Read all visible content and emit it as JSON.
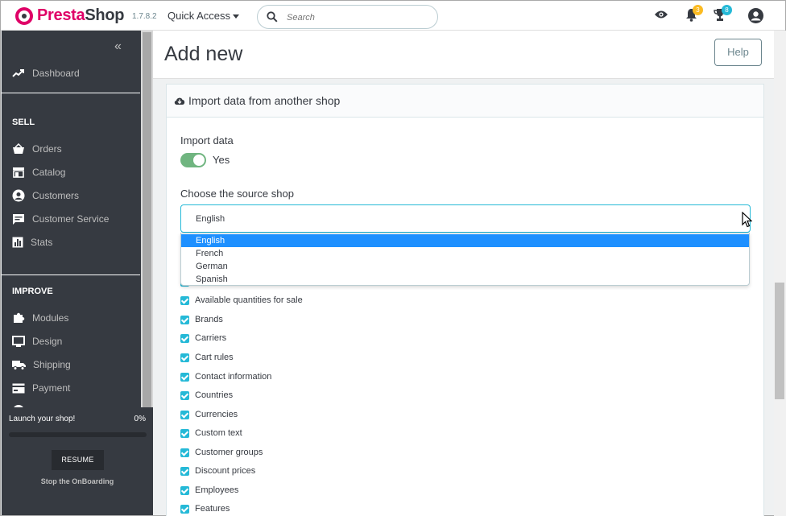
{
  "app": {
    "brand_presta": "Presta",
    "brand_shop": "Shop",
    "version": "1.7.8.2",
    "quick_access": "Quick Access",
    "search_placeholder": "Search",
    "notifications_count": "3",
    "trophy_count": "8"
  },
  "sidebar": {
    "dashboard": "Dashboard",
    "sell_heading": "SELL",
    "sell_items": [
      "Orders",
      "Catalog",
      "Customers",
      "Customer Service",
      "Stats"
    ],
    "improve_heading": "IMPROVE",
    "improve_items": [
      "Modules",
      "Design",
      "Shipping",
      "Payment"
    ]
  },
  "onboarding": {
    "title": "Launch your shop!",
    "percent": "0%",
    "progress": 0,
    "resume": "RESUME",
    "stop": "Stop the OnBoarding"
  },
  "page": {
    "title": "Add new",
    "help": "Help"
  },
  "card": {
    "header": "Import data from another shop",
    "import_label": "Import data",
    "import_value": "Yes",
    "source_label": "Choose the source shop",
    "selected_shop": "English",
    "shop_options": [
      "English",
      "French",
      "German",
      "Spanish"
    ],
    "checkboxes": [
      "Available quantities for sale",
      "Brands",
      "Carriers",
      "Cart rules",
      "Contact information",
      "Countries",
      "Currencies",
      "Custom text",
      "Customer groups",
      "Discount prices",
      "Employees",
      "Features"
    ]
  },
  "colors": {
    "brand": "#df0067",
    "sidebar": "#363a41",
    "accent": "#25b9d7",
    "switch_on": "#70b580",
    "selected_option": "#1e90ff"
  }
}
